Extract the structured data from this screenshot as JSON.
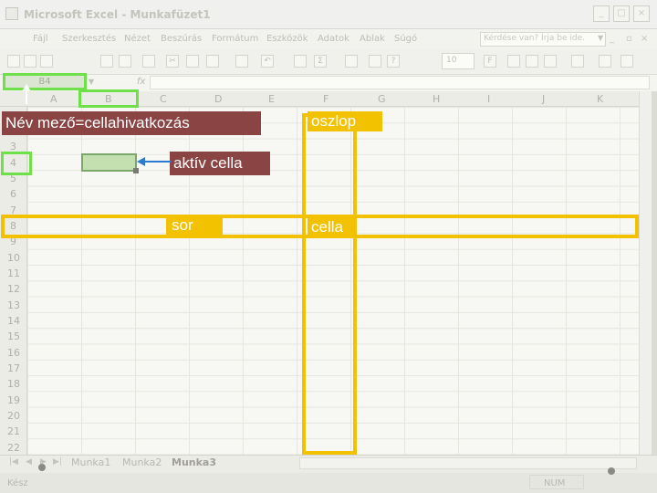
{
  "window": {
    "title": "Microsoft Excel - Munkafüzet1",
    "controls": [
      "_",
      "□",
      "×"
    ]
  },
  "menu": {
    "items": [
      "Fájl",
      "Szerkesztés",
      "Nézet",
      "Beszúrás",
      "Formátum",
      "Eszközök",
      "Adatok",
      "Ablak",
      "Súgó"
    ],
    "help_placeholder": "Kérdése van? Írja be ide."
  },
  "toolbar": {
    "font_size": "10",
    "bold": "F"
  },
  "formula_bar": {
    "name_box": "B4",
    "fx": "fx",
    "content": ""
  },
  "grid": {
    "columns": [
      "A",
      "B",
      "C",
      "D",
      "E",
      "F",
      "G",
      "H",
      "I",
      "J",
      "K"
    ],
    "rows": [
      "3",
      "4",
      "5",
      "6",
      "7",
      "8",
      "9",
      "10",
      "11",
      "12",
      "13",
      "14",
      "15",
      "16",
      "17",
      "18",
      "19",
      "20",
      "21",
      "22"
    ]
  },
  "sheets": {
    "tabs": [
      "Munka1",
      "Munka2",
      "Munka3"
    ],
    "active": "Munka3"
  },
  "status": {
    "left": "Kész",
    "num": "NUM"
  },
  "annotations": {
    "name_box_label": "Név mező=cellahivatkozás",
    "column_label": "oszlop",
    "active_cell_label": "aktív cella",
    "row_label": "sor",
    "cell_label": "cella",
    "colors": {
      "label_bg": "#8b4444",
      "yellow": "#f2c200",
      "green": "#6ee04a",
      "arrow": "#2a7ad4"
    }
  }
}
